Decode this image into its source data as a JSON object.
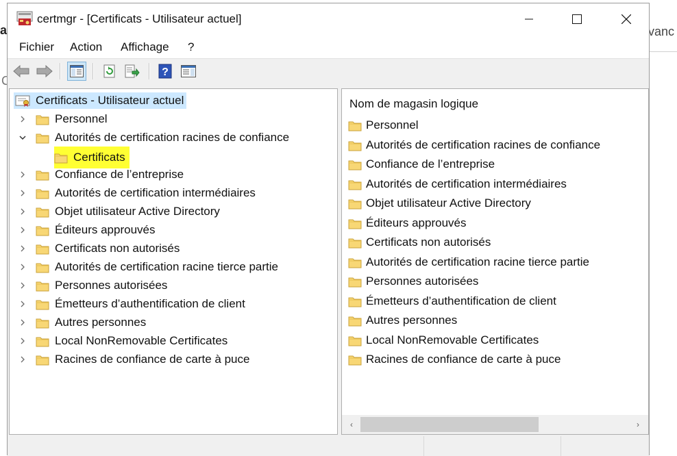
{
  "background_window": {
    "left_fragment": "a",
    "left_fragment_2": "C",
    "right_fragment": "vanc"
  },
  "window": {
    "title": "certmgr - [Certificats - Utilisateur actuel]",
    "controls": {
      "minimize": "—",
      "maximize": "☐",
      "close": "✕"
    }
  },
  "menu": {
    "file": "Fichier",
    "action": "Action",
    "view": "Affichage",
    "help": "?"
  },
  "toolbar": {
    "back_icon": "back-arrow-icon",
    "forward_icon": "forward-arrow-icon",
    "show_hide_tree_icon": "console-tree-icon",
    "refresh_icon": "refresh-icon",
    "export_icon": "export-list-icon",
    "help_icon": "help-icon",
    "properties_icon": "properties-pane-icon"
  },
  "tree": {
    "root": "Certificats - Utilisateur actuel",
    "items": [
      {
        "label": "Personnel",
        "expanded": false
      },
      {
        "label": "Autorités de certification racines de confiance",
        "expanded": true,
        "children": [
          {
            "label": "Certificats",
            "highlighted": true
          }
        ]
      },
      {
        "label": "Confiance de l’entreprise",
        "expanded": false
      },
      {
        "label": "Autorités de certification intermédiaires",
        "expanded": false
      },
      {
        "label": "Objet utilisateur Active Directory",
        "expanded": false
      },
      {
        "label": "Éditeurs approuvés",
        "expanded": false
      },
      {
        "label": "Certificats non autorisés",
        "expanded": false
      },
      {
        "label": "Autorités de certification racine tierce partie",
        "expanded": false
      },
      {
        "label": "Personnes autorisées",
        "expanded": false
      },
      {
        "label": "Émetteurs d’authentification de client",
        "expanded": false
      },
      {
        "label": "Autres personnes",
        "expanded": false
      },
      {
        "label": "Local NonRemovable Certificates",
        "expanded": false
      },
      {
        "label": "Racines de confiance de carte à puce",
        "expanded": false
      }
    ]
  },
  "list": {
    "column_header": "Nom de magasin logique",
    "items": [
      "Personnel",
      "Autorités de certification racines de confiance",
      "Confiance de l’entreprise",
      "Autorités de certification intermédiaires",
      "Objet utilisateur Active Directory",
      "Éditeurs approuvés",
      "Certificats non autorisés",
      "Autorités de certification racine tierce partie",
      "Personnes autorisées",
      "Émetteurs d’authentification de client",
      "Autres personnes",
      "Local NonRemovable Certificates",
      "Racines de confiance de carte à puce"
    ],
    "scroll_left": "‹",
    "scroll_right": "›"
  },
  "colors": {
    "selection": "#cce8ff",
    "highlight": "#ffff33",
    "folder": "#f8d775"
  }
}
